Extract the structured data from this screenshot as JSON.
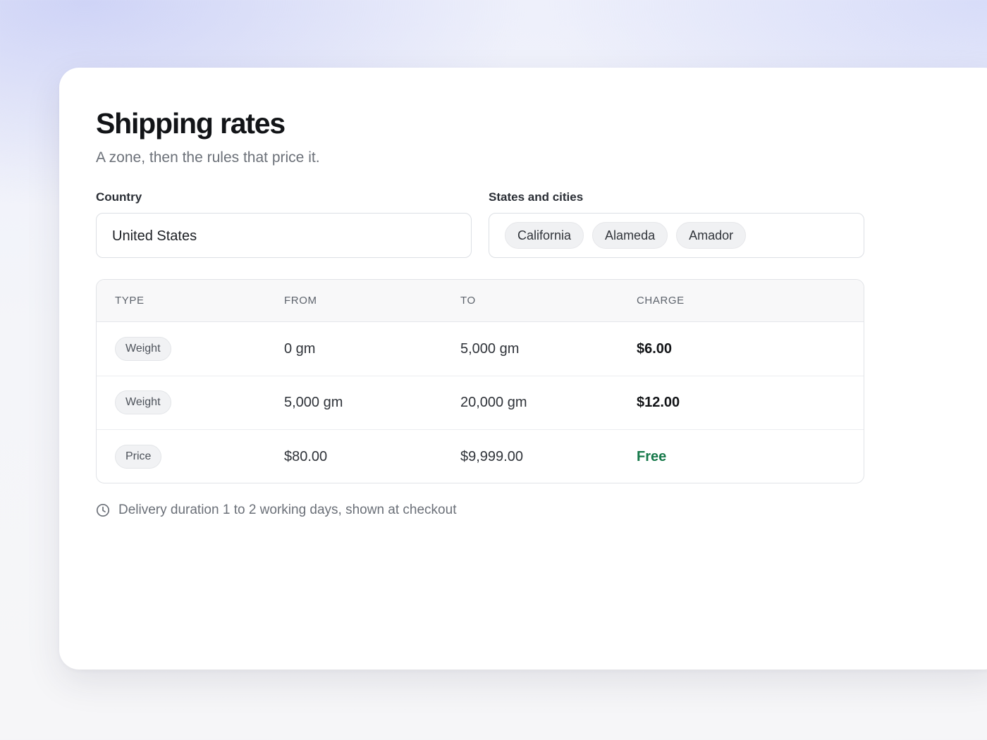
{
  "header": {
    "title": "Shipping rates",
    "subtitle": "A zone, then the rules that price it."
  },
  "country": {
    "label": "Country",
    "value": "United States"
  },
  "states": {
    "label": "States and cities",
    "chips": [
      "California",
      "Alameda",
      "Amador"
    ]
  },
  "table": {
    "columns": [
      "TYPE",
      "FROM",
      "TO",
      "CHARGE"
    ],
    "rows": [
      {
        "type": "Weight",
        "from": "0 gm",
        "to": "5,000 gm",
        "charge": "$6.00"
      },
      {
        "type": "Weight",
        "from": "5,000 gm",
        "to": "20,000 gm",
        "charge": "$12.00"
      },
      {
        "type": "Price",
        "from": "$80.00",
        "to": "$9,999.00",
        "charge": "Free"
      }
    ]
  },
  "note": {
    "icon": "clock-icon",
    "text": "Delivery duration 1 to 2 working days, shown at checkout"
  },
  "colors": {
    "free": "#16794a",
    "muted": "#6b7078",
    "chip_bg": "#f0f1f3"
  }
}
